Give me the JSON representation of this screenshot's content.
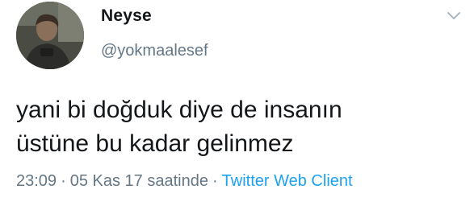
{
  "user": {
    "name": "Neyse",
    "handle": "@yokmaalesef"
  },
  "tweet": {
    "lines": [
      "yani bi doğduk diye de insanın",
      "üstüne bu kadar gelinmez"
    ]
  },
  "meta": {
    "time": "23:09",
    "separator": "·",
    "date_text": "05 Kas 17 saatinde",
    "source": "Twitter Web Client"
  },
  "icons": {
    "menu": "chevron-down-icon",
    "avatar": "avatar"
  },
  "colors": {
    "text": "#14171a",
    "secondary": "#657786",
    "link": "#1da1f2",
    "background": "#ffffff"
  }
}
